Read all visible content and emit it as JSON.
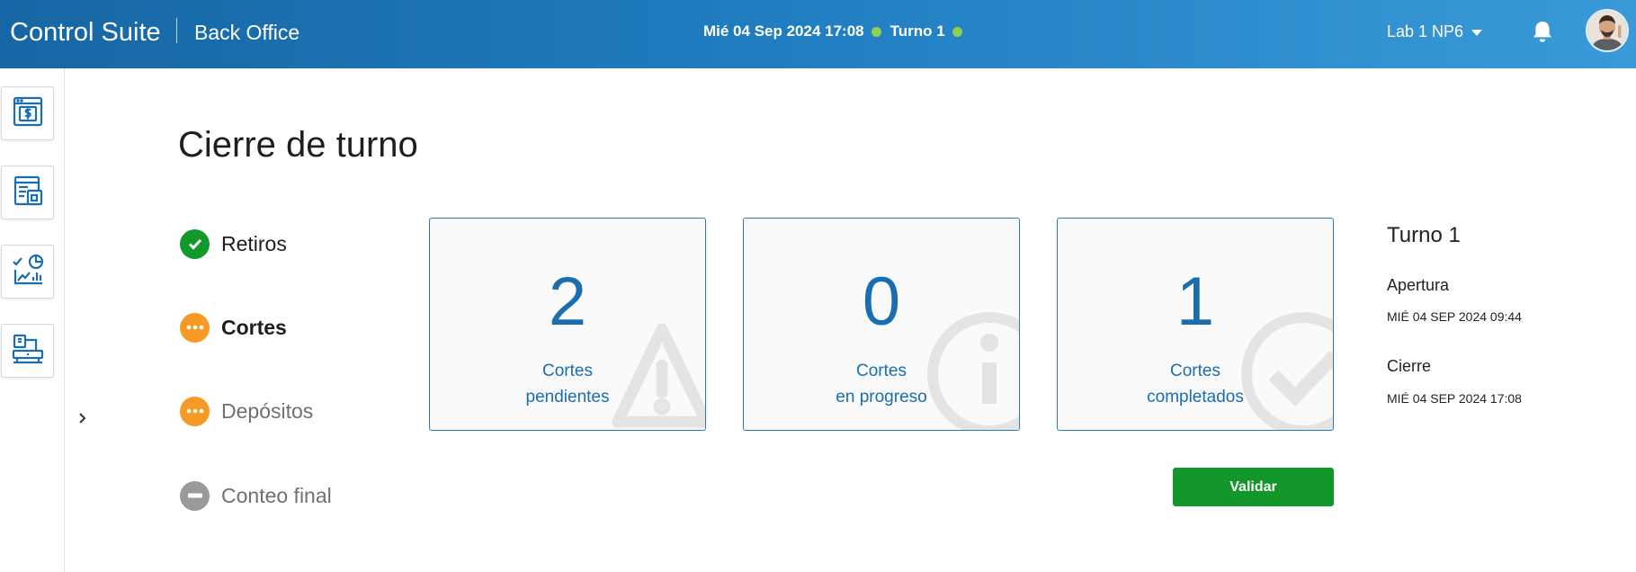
{
  "header": {
    "brand": "Control Suite",
    "module": "Back Office",
    "datetime": "Mié 04 Sep 2024 17:08",
    "shift": "Turno 1",
    "site": "Lab 1 NP6",
    "notification_icon": "bell-icon",
    "status_color": "#8fd14f"
  },
  "sidebar": {
    "items": [
      {
        "name": "cash-register-icon"
      },
      {
        "name": "reports-icon"
      },
      {
        "name": "analytics-icon"
      },
      {
        "name": "terminal-icon"
      }
    ],
    "expand_icon": "chevron-right-icon"
  },
  "page": {
    "title": "Cierre de turno"
  },
  "steps": [
    {
      "label": "Retiros",
      "state": "completed",
      "color": "#12982b"
    },
    {
      "label": "Cortes",
      "state": "active",
      "color": "#f49a25"
    },
    {
      "label": "Depósitos",
      "state": "pending",
      "color": "#f49a25"
    },
    {
      "label": "Conteo final",
      "state": "disabled",
      "color": "#9a9a9a"
    }
  ],
  "cards": [
    {
      "value": "2",
      "line1": "Cortes",
      "line2": "pendientes",
      "icon": "warning-icon"
    },
    {
      "value": "0",
      "line1": "Cortes",
      "line2": "en progreso",
      "icon": "info-icon"
    },
    {
      "value": "1",
      "line1": "Cortes",
      "line2": "completados",
      "icon": "check-circle-icon"
    }
  ],
  "actions": {
    "validate": "Validar"
  },
  "shift_info": {
    "title": "Turno 1",
    "opening_label": "Apertura",
    "opening_value": "MIÉ 04 SEP 2024 09:44",
    "closing_label": "Cierre",
    "closing_value": "MIÉ 04 SEP 2024 17:08"
  }
}
